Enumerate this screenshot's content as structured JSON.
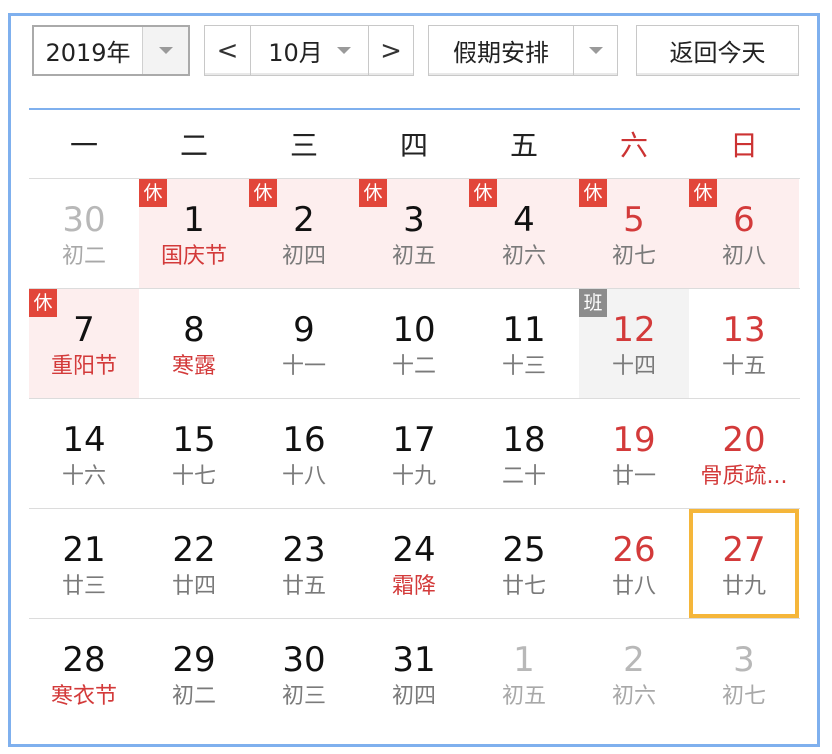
{
  "toolbar": {
    "year": "2019年",
    "prev": "<",
    "month": "10月",
    "next": ">",
    "holiday": "假期安排",
    "today_button": "返回今天"
  },
  "weekdays": [
    "一",
    "二",
    "三",
    "四",
    "五",
    "六",
    "日"
  ],
  "weeks": [
    [
      {
        "day": "30",
        "lunar": "初二",
        "other": true
      },
      {
        "day": "1",
        "lunar": "国庆节",
        "badge": "休",
        "festival": true
      },
      {
        "day": "2",
        "lunar": "初四",
        "badge": "休"
      },
      {
        "day": "3",
        "lunar": "初五",
        "badge": "休"
      },
      {
        "day": "4",
        "lunar": "初六",
        "badge": "休"
      },
      {
        "day": "5",
        "lunar": "初七",
        "badge": "休",
        "weekend": true
      },
      {
        "day": "6",
        "lunar": "初八",
        "badge": "休",
        "weekend": true
      }
    ],
    [
      {
        "day": "7",
        "lunar": "重阳节",
        "badge": "休",
        "festival": true
      },
      {
        "day": "8",
        "lunar": "寒露",
        "festival": true
      },
      {
        "day": "9",
        "lunar": "十一"
      },
      {
        "day": "10",
        "lunar": "十二"
      },
      {
        "day": "11",
        "lunar": "十三"
      },
      {
        "day": "12",
        "lunar": "十四",
        "badge": "班",
        "weekend": true
      },
      {
        "day": "13",
        "lunar": "十五",
        "weekend": true
      }
    ],
    [
      {
        "day": "14",
        "lunar": "十六"
      },
      {
        "day": "15",
        "lunar": "十七"
      },
      {
        "day": "16",
        "lunar": "十八"
      },
      {
        "day": "17",
        "lunar": "十九"
      },
      {
        "day": "18",
        "lunar": "二十"
      },
      {
        "day": "19",
        "lunar": "廿一",
        "weekend": true
      },
      {
        "day": "20",
        "lunar": "骨质疏...",
        "festival": true,
        "weekend": true
      }
    ],
    [
      {
        "day": "21",
        "lunar": "廿三"
      },
      {
        "day": "22",
        "lunar": "廿四"
      },
      {
        "day": "23",
        "lunar": "廿五"
      },
      {
        "day": "24",
        "lunar": "霜降",
        "festival": true
      },
      {
        "day": "25",
        "lunar": "廿七"
      },
      {
        "day": "26",
        "lunar": "廿八",
        "weekend": true
      },
      {
        "day": "27",
        "lunar": "廿九",
        "weekend": true,
        "today": true
      }
    ],
    [
      {
        "day": "28",
        "lunar": "寒衣节",
        "festival": true
      },
      {
        "day": "29",
        "lunar": "初二"
      },
      {
        "day": "30",
        "lunar": "初三"
      },
      {
        "day": "31",
        "lunar": "初四"
      },
      {
        "day": "1",
        "lunar": "初五",
        "other": true
      },
      {
        "day": "2",
        "lunar": "初六",
        "other": true
      },
      {
        "day": "3",
        "lunar": "初七",
        "other": true
      }
    ]
  ]
}
